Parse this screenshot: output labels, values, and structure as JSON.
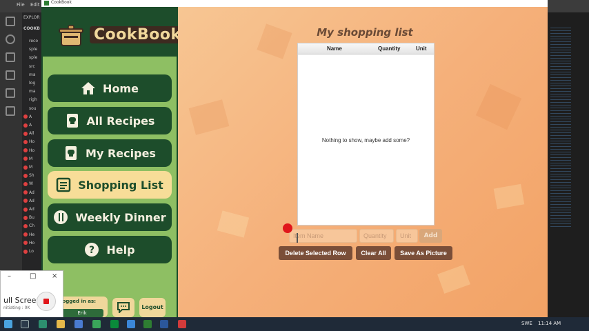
{
  "app": {
    "title": "CookBook",
    "logo_text": "CookBook"
  },
  "nav": {
    "items": [
      {
        "label": "Home",
        "icon": "home-icon"
      },
      {
        "label": "All Recipes",
        "icon": "book-icon"
      },
      {
        "label": "My Recipes",
        "icon": "book-icon"
      },
      {
        "label": "Shopping List",
        "icon": "list-icon",
        "active": true
      },
      {
        "label": "Weekly Dinner",
        "icon": "cutlery-icon"
      },
      {
        "label": "Help",
        "icon": "question-icon"
      }
    ]
  },
  "user": {
    "logged_in_label": "Logged in as:",
    "username": "Erik",
    "logout_label": "Logout"
  },
  "shopping": {
    "title": "My shopping list",
    "columns": [
      "Name",
      "Quantity",
      "Unit"
    ],
    "empty_message": "Nothing to show, maybe add some?",
    "item_name_placeholder": "Item Name",
    "quantity_placeholder": "Quantity",
    "unit_placeholder": "Unit",
    "add_label": "Add",
    "delete_label": "Delete Selected Row",
    "clear_label": "Clear All",
    "save_label": "Save As Picture"
  },
  "recorder": {
    "title": "ull Screen",
    "status": "nitiating : 0K"
  },
  "taskbar": {
    "lang": "SWE",
    "time": "11:14 AM"
  },
  "vscode": {
    "menu": [
      "File",
      "Edit"
    ],
    "explorer_label": "EXPLOR",
    "explorer_section": "COOKB",
    "files": [
      "reco",
      "sple",
      "sple",
      "src",
      "ma",
      "log",
      "ma",
      "righ",
      "sou",
      "A",
      "A",
      "All",
      "Ho",
      "Ho",
      "M",
      "M",
      "Sh",
      "W",
      "Ad",
      "Ad",
      "Ad",
      "Bu",
      "Ch",
      "He",
      "Ho",
      "Lo"
    ]
  },
  "colors": {
    "sidebar_dark": "#1d4d2b",
    "sidebar_light": "#8ebf63",
    "active_nav": "#f7dd98",
    "action_button": "#7a4e38",
    "content_bg": "#f5b07a"
  }
}
